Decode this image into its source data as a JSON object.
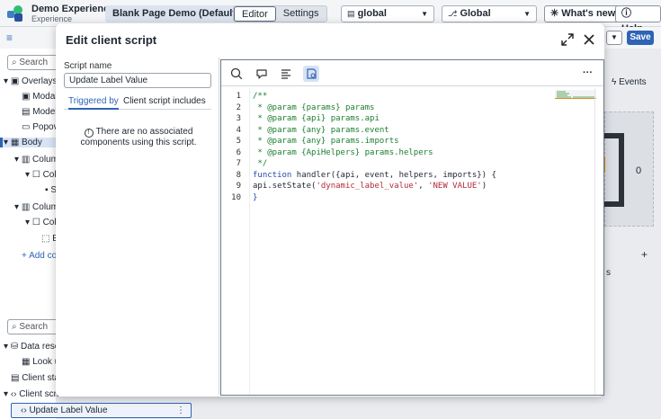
{
  "app": {
    "title": "Demo Experience",
    "subtitle": "Experience",
    "page_pill": "Blank Page Demo (Default)",
    "mode_tabs": [
      "Editor",
      "Settings"
    ],
    "scope_value": "global",
    "app_value": "Global",
    "whats_new": "What's new",
    "help": "Help",
    "save": "Save"
  },
  "left_panel": {
    "search_placeholder": "Search",
    "tree_items": [
      "Overlays",
      "Modal",
      "Model",
      "Popov",
      "Body",
      "Colum",
      "Colu",
      "S",
      "Colum",
      "Colu",
      "E",
      "Add co"
    ],
    "search2_placeholder": "Search",
    "data_items": [
      "Data reso",
      "Look u",
      "Client sta",
      "Client scri"
    ],
    "selected_script": "Update Label Value"
  },
  "right_panel": {
    "events_tab": "Events",
    "zero_a": "0",
    "zero_b": "0",
    "plus": "+",
    "s_text": "s"
  },
  "modal": {
    "title": "Edit client script",
    "script_name_label": "Script name",
    "script_name_value": "Update Label Value",
    "tabs": [
      "Triggered by",
      "Client script includes"
    ],
    "empty_message": "There are no associated components using this script.",
    "editor": {
      "line_numbers": [
        "1",
        "2",
        "3",
        "4",
        "5",
        "6",
        "7",
        "8",
        "9",
        "10"
      ],
      "lines": [
        "/**",
        " * @param {params} params",
        " * @param {api} params.api",
        " * @param {any} params.event",
        " * @param {any} params.imports",
        " * @param {ApiHelpers} params.helpers",
        " */",
        "",
        "",
        "}"
      ],
      "line8_kw": "function",
      "line8_rest": " handler({api, event, helpers, imports}) {",
      "line9_pre": "api.setState(",
      "line9_s1": "'dynamic_label_value'",
      "line9_mid": ", ",
      "line9_s2": "'NEW VALUE'",
      "line9_post": ")"
    }
  }
}
